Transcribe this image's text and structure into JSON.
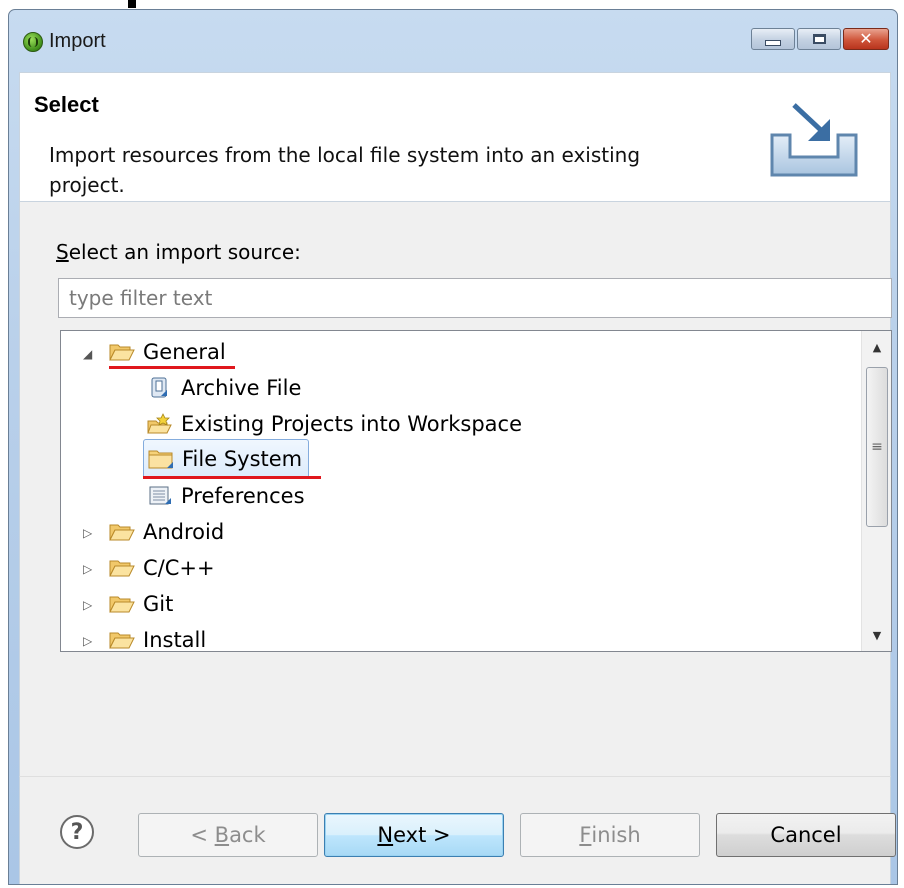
{
  "window": {
    "title": "Import"
  },
  "header": {
    "title": "Select",
    "description": "Import resources from the local file system into an existing project."
  },
  "source": {
    "label_mnemonic": "S",
    "label_rest": "elect an import source:",
    "filter_placeholder": "type filter text"
  },
  "tree": {
    "items": [
      {
        "label": "General",
        "expanded": true,
        "icon": "folder-open-icon"
      },
      {
        "label": "Archive File",
        "icon": "archive-file-icon"
      },
      {
        "label": "Existing Projects into Workspace",
        "icon": "import-project-icon"
      },
      {
        "label": "File System",
        "icon": "folder-icon",
        "selected": true
      },
      {
        "label": "Preferences",
        "icon": "preferences-icon"
      },
      {
        "label": "Android",
        "expanded": false,
        "icon": "folder-open-icon"
      },
      {
        "label": "C/C++",
        "expanded": false,
        "icon": "folder-open-icon"
      },
      {
        "label": "Git",
        "expanded": false,
        "icon": "folder-open-icon"
      },
      {
        "label": "Install",
        "expanded": false,
        "icon": "folder-open-icon"
      }
    ]
  },
  "buttons": {
    "back_prefix": "< ",
    "back_mnemonic": "B",
    "back_rest": "ack",
    "next_mnemonic": "N",
    "next_rest": "ext >",
    "finish_mnemonic": "F",
    "finish_rest": "inish",
    "cancel": "Cancel"
  },
  "colors": {
    "annotation_underline": "#e0171d",
    "selection_border": "#84acdd",
    "title_bar": "#b9d0ea"
  }
}
